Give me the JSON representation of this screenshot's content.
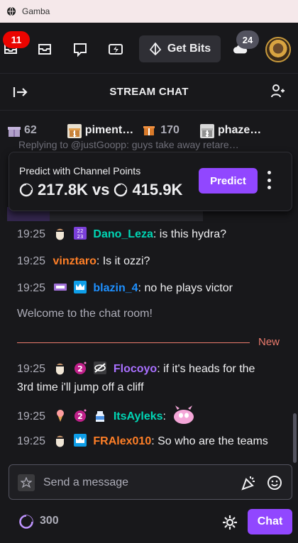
{
  "window": {
    "title": "Gamba"
  },
  "nav": {
    "notification_count": "11",
    "get_bits_label": "Get Bits",
    "whisper_count": "24"
  },
  "chat_header": {
    "title": "STREAM CHAT"
  },
  "leaderboard": [
    {
      "name": "",
      "count": "62"
    },
    {
      "name": "piment…",
      "count": "170"
    },
    {
      "name": "phaze…",
      "count": ""
    }
  ],
  "reply_preview": "Replying to @justGoopp: guys take away retare…",
  "prediction": {
    "title": "Predict with Channel Points",
    "left_points": "217.8K",
    "vs": "vs",
    "right_points": "415.9K",
    "button_label": "Predict"
  },
  "messages": [
    {
      "time": "19:25",
      "user": "Dano_Leza",
      "color": "#00d6b5",
      "text": ": is this hydra?",
      "badges": [
        "latte",
        "sub-purple"
      ]
    },
    {
      "time": "19:25",
      "user": "vinztaro",
      "color": "#ff7f27",
      "text": ": Is it ozzi?",
      "badges": []
    },
    {
      "time": "19:25",
      "user": "blazin_4",
      "color": "#1e90ff",
      "text": ": no he plays victor",
      "badges": [
        "ticket",
        "prime-crown"
      ]
    },
    {
      "time": "19:25",
      "user": "Flocoyo",
      "color": "#a970ff",
      "text": ": if it's heads for the",
      "text2": "3rd time i'll jump off a cliff",
      "badges": [
        "latte",
        "gift-2",
        "no-audio"
      ]
    },
    {
      "time": "19:25",
      "user": "ItsAyleks",
      "color": "#00d6b5",
      "text": ":",
      "badges": [
        "icecream",
        "gift-2",
        "milk"
      ]
    },
    {
      "time": "19:25",
      "user": "FRAlex010",
      "color": "#ff7f27",
      "text": ": So who are the teams",
      "badges": [
        "latte",
        "prime-crown"
      ]
    }
  ],
  "welcome_text": "Welcome to the chat room!",
  "new_label": "New",
  "input": {
    "placeholder": "Send a message"
  },
  "footer": {
    "points": "300",
    "chat_button": "Chat"
  },
  "colors": {
    "accent": "#9147ff",
    "new_line": "#eb7b6d",
    "background": "#18181b"
  },
  "icons": [
    "globe-icon",
    "inbox-icon",
    "mail-icon",
    "whisper-icon",
    "bits-icon",
    "gem-icon",
    "cloud-icon",
    "collapse-icon",
    "users-icon",
    "gift-icon",
    "channel-points-icon",
    "kebab-icon",
    "star-icon",
    "party-icon",
    "emote-icon",
    "gear-icon"
  ]
}
